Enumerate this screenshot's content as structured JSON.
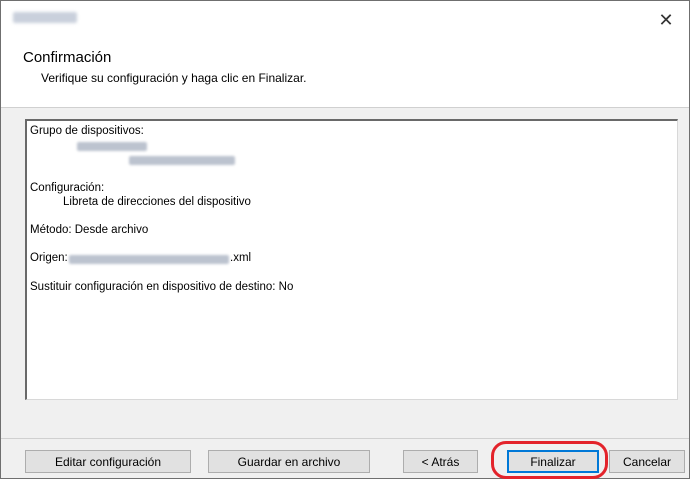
{
  "window": {
    "close_glyph": "✕",
    "title_redacted": true
  },
  "header": {
    "title": "Confirmación",
    "subtitle": "Verifique su configuración y haga clic en Finalizar."
  },
  "summary": {
    "group_label": "Grupo de dispositivos:",
    "config_label": "Configuración:",
    "config_value": "Libreta de direcciones del dispositivo",
    "method_line": "Método: Desde archivo",
    "origin_label": "Origen:",
    "origin_suffix": ".xml",
    "replace_line": "Sustituir configuración en dispositivo de destino: No"
  },
  "buttons": {
    "edit": "Editar configuración",
    "save": "Guardar en archivo",
    "back": "< Atrás",
    "finish": "Finalizar",
    "cancel": "Cancelar"
  },
  "colors": {
    "accent": "#0078d7",
    "highlight": "#e3232b"
  }
}
